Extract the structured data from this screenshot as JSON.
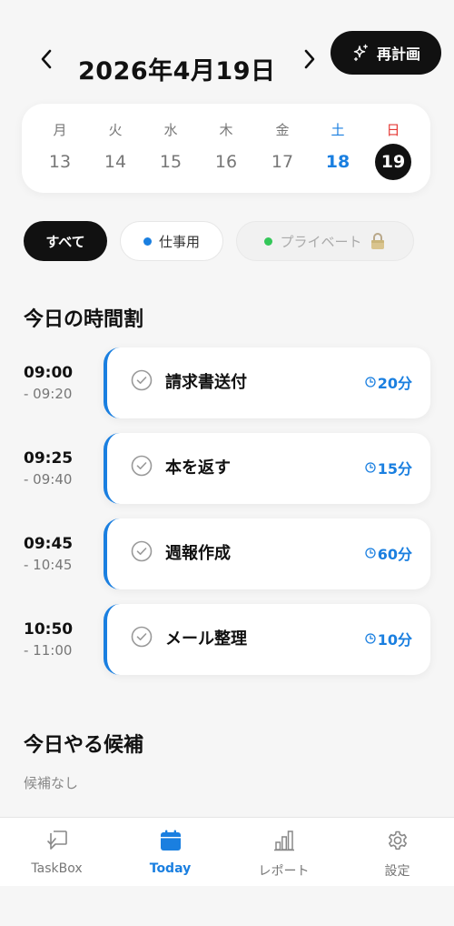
{
  "header": {
    "date_title": "2026年4月19日",
    "replan_label": "再計画"
  },
  "week": [
    {
      "name": "月",
      "num": "13"
    },
    {
      "name": "火",
      "num": "14"
    },
    {
      "name": "水",
      "num": "15"
    },
    {
      "name": "木",
      "num": "16"
    },
    {
      "name": "金",
      "num": "17"
    },
    {
      "name": "土",
      "num": "18"
    },
    {
      "name": "日",
      "num": "19"
    }
  ],
  "filters": {
    "all": "すべて",
    "work": "仕事用",
    "private": "プライベート"
  },
  "schedule": {
    "title": "今日の時間割",
    "items": [
      {
        "start": "09:00",
        "end": "- 09:20",
        "title": "請求書送付",
        "duration": "20分"
      },
      {
        "start": "09:25",
        "end": "- 09:40",
        "title": "本を返す",
        "duration": "15分"
      },
      {
        "start": "09:45",
        "end": "- 10:45",
        "title": "週報作成",
        "duration": "60分"
      },
      {
        "start": "10:50",
        "end": "- 11:00",
        "title": "メール整理",
        "duration": "10分"
      }
    ]
  },
  "candidates": {
    "title": "今日やる候補",
    "empty_text": "候補なし"
  },
  "tabbar": {
    "taskbox": "TaskBox",
    "today": "Today",
    "report": "レポート",
    "settings": "設定"
  },
  "colors": {
    "accent": "#1a7fe0",
    "saturday": "#1a7fe0",
    "sunday": "#e53935",
    "private_dot": "#34c759",
    "dark": "#111111"
  },
  "icons": {
    "prev": "chevron-left-icon",
    "next": "chevron-right-icon",
    "replan": "sparkles-icon",
    "private_lock": "lock-icon",
    "task_check": "check-circle-icon",
    "duration": "clock-icon",
    "taskbox": "inbox-icon",
    "today": "calendar-icon",
    "report": "bar-chart-icon",
    "settings": "gear-icon"
  }
}
